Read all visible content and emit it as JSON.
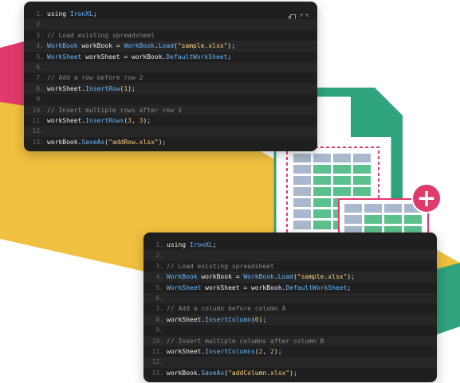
{
  "colors": {
    "yellow_band": "#f0c040",
    "pink_band": "#e03a6c",
    "green": "#2fa27e",
    "code_bg": "#1f1f1f"
  },
  "icons": [
    "copy-icon",
    "fullscreen-icon",
    "spreadsheet-file-icon",
    "plus-icon"
  ],
  "top_snippet": {
    "lines": [
      {
        "n": "1.",
        "parts": [
          {
            "t": "using ",
            "c": ""
          },
          {
            "t": "IronXL",
            "c": "typ"
          },
          {
            "t": ";",
            "c": ""
          }
        ]
      },
      {
        "n": "2.",
        "parts": []
      },
      {
        "n": "3.",
        "parts": [
          {
            "t": "// Load existing spreadsheet",
            "c": "cmt"
          }
        ]
      },
      {
        "n": "4.",
        "parts": [
          {
            "t": "WorkBook",
            "c": "typ"
          },
          {
            "t": " workBook = ",
            "c": ""
          },
          {
            "t": "WorkBook",
            "c": "typ"
          },
          {
            "t": ".",
            "c": ""
          },
          {
            "t": "Load",
            "c": "fn"
          },
          {
            "t": "(",
            "c": ""
          },
          {
            "t": "\"sample.xlsx\"",
            "c": "str"
          },
          {
            "t": ");",
            "c": ""
          }
        ]
      },
      {
        "n": "5.",
        "parts": [
          {
            "t": "WorkSheet",
            "c": "typ"
          },
          {
            "t": " workSheet = workBook.",
            "c": ""
          },
          {
            "t": "DefaultWorkSheet",
            "c": "typ"
          },
          {
            "t": ";",
            "c": ""
          }
        ]
      },
      {
        "n": "6.",
        "parts": []
      },
      {
        "n": "7.",
        "parts": [
          {
            "t": "// Add a row before row 2",
            "c": "cmt"
          }
        ]
      },
      {
        "n": "8.",
        "parts": [
          {
            "t": "workSheet.",
            "c": ""
          },
          {
            "t": "InsertRow",
            "c": "fn"
          },
          {
            "t": "(",
            "c": ""
          },
          {
            "t": "1",
            "c": "num"
          },
          {
            "t": ");",
            "c": ""
          }
        ]
      },
      {
        "n": "9.",
        "parts": []
      },
      {
        "n": "10.",
        "parts": [
          {
            "t": "// Insert multiple rows after row 3",
            "c": "cmt"
          }
        ]
      },
      {
        "n": "11.",
        "parts": [
          {
            "t": "workSheet.",
            "c": ""
          },
          {
            "t": "InsertRows",
            "c": "fn"
          },
          {
            "t": "(",
            "c": ""
          },
          {
            "t": "3",
            "c": "num"
          },
          {
            "t": ", ",
            "c": ""
          },
          {
            "t": "3",
            "c": "num"
          },
          {
            "t": ");",
            "c": ""
          }
        ]
      },
      {
        "n": "12.",
        "parts": []
      },
      {
        "n": "13.",
        "parts": [
          {
            "t": "workBook.",
            "c": ""
          },
          {
            "t": "SaveAs",
            "c": "fn"
          },
          {
            "t": "(",
            "c": ""
          },
          {
            "t": "\"addRow.xlsx\"",
            "c": "str"
          },
          {
            "t": ");",
            "c": ""
          }
        ]
      }
    ]
  },
  "bottom_snippet": {
    "lines": [
      {
        "n": "1.",
        "parts": [
          {
            "t": "using ",
            "c": ""
          },
          {
            "t": "IronXL",
            "c": "typ"
          },
          {
            "t": ";",
            "c": ""
          }
        ]
      },
      {
        "n": "2.",
        "parts": []
      },
      {
        "n": "3.",
        "parts": [
          {
            "t": "// Load existing spreadsheet",
            "c": "cmt"
          }
        ]
      },
      {
        "n": "4.",
        "parts": [
          {
            "t": "WorkBook",
            "c": "typ"
          },
          {
            "t": " workBook = ",
            "c": ""
          },
          {
            "t": "WorkBook",
            "c": "typ"
          },
          {
            "t": ".",
            "c": ""
          },
          {
            "t": "Load",
            "c": "fn"
          },
          {
            "t": "(",
            "c": ""
          },
          {
            "t": "\"sample.xlsx\"",
            "c": "str"
          },
          {
            "t": ");",
            "c": ""
          }
        ]
      },
      {
        "n": "5.",
        "parts": [
          {
            "t": "WorkSheet",
            "c": "typ"
          },
          {
            "t": " workSheet = workBook.",
            "c": ""
          },
          {
            "t": "DefaultWorkSheet",
            "c": "typ"
          },
          {
            "t": ";",
            "c": ""
          }
        ]
      },
      {
        "n": "6.",
        "parts": []
      },
      {
        "n": "7.",
        "parts": [
          {
            "t": "// Add a column before column A",
            "c": "cmt"
          }
        ]
      },
      {
        "n": "8.",
        "parts": [
          {
            "t": "workSheet.",
            "c": ""
          },
          {
            "t": "InsertColumn",
            "c": "fn"
          },
          {
            "t": "(",
            "c": ""
          },
          {
            "t": "0",
            "c": "num"
          },
          {
            "t": ");",
            "c": ""
          }
        ]
      },
      {
        "n": "9.",
        "parts": []
      },
      {
        "n": "10.",
        "parts": [
          {
            "t": "// Insert multiple columns after column B",
            "c": "cmt"
          }
        ]
      },
      {
        "n": "11.",
        "parts": [
          {
            "t": "workSheet.",
            "c": ""
          },
          {
            "t": "InsertColumns",
            "c": "fn"
          },
          {
            "t": "(",
            "c": ""
          },
          {
            "t": "2",
            "c": "num"
          },
          {
            "t": ", ",
            "c": ""
          },
          {
            "t": "2",
            "c": "num"
          },
          {
            "t": ");",
            "c": ""
          }
        ]
      },
      {
        "n": "12.",
        "parts": []
      },
      {
        "n": "13.",
        "parts": [
          {
            "t": "workBook.",
            "c": ""
          },
          {
            "t": "SaveAs",
            "c": "fn"
          },
          {
            "t": "(",
            "c": ""
          },
          {
            "t": "\"addColumn.xlsx\"",
            "c": "str"
          },
          {
            "t": ");",
            "c": ""
          }
        ]
      }
    ]
  },
  "plus_badge": "+"
}
